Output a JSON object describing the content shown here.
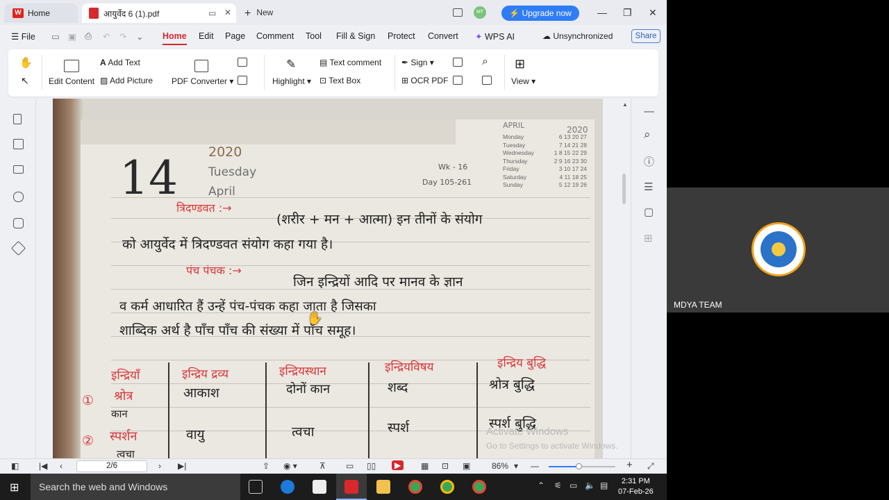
{
  "tabs": {
    "home": "Home",
    "document": "आयुर्वेद 6 (1).pdf",
    "new": "New"
  },
  "avatar_initials": "MT",
  "upgrade": "Upgrade now",
  "menu": {
    "file": "File",
    "home": "Home",
    "edit": "Edit",
    "page": "Page",
    "comment": "Comment",
    "tool": "Tool",
    "fill_sign": "Fill & Sign",
    "protect": "Protect",
    "convert": "Convert",
    "wps_ai": "WPS AI",
    "sync": "Unsynchronized",
    "share": "Share"
  },
  "ribbon": {
    "edit_content": "Edit Content",
    "add_text": "Add Text",
    "add_picture": "Add Picture",
    "pdf_converter": "PDF Converter",
    "highlight": "Highlight",
    "text_comment": "Text comment",
    "text_box": "Text Box",
    "sign": "Sign",
    "ocr_pdf": "OCR PDF",
    "view": "View"
  },
  "document": {
    "day_number": "14",
    "year": "2020",
    "weekday": "Tuesday",
    "month": "April",
    "week": "Wk - 16",
    "day_of_year": "Day 105-261",
    "calendar": {
      "month": "APRIL",
      "year": "2020",
      "rows": [
        [
          "Monday",
          "6 13 20 27"
        ],
        [
          "Tuesday",
          "7 14 21 28"
        ],
        [
          "Wednesday",
          "1 8 15 22 29"
        ],
        [
          "Thursday",
          "2 9 16 23 30"
        ],
        [
          "Friday",
          "3 10 17 24"
        ],
        [
          "Saturday",
          "4 11 18 25"
        ],
        [
          "Sunday",
          "5 12 19 26"
        ]
      ]
    },
    "heading1": "त्रिदण्डवत :→",
    "line1": "(शरीर + मन + आत्मा) इन तीनों के संयोग",
    "line2": "को आयुर्वेद में त्रिदण्डवत संयोग कहा गया है।",
    "heading2": "पंच पंचक :→",
    "line3": "जिन इन्द्रियों आदि पर मानव के ज्ञान",
    "line4": "व कर्म आधारित हैं उन्हें पंच-पंचक कहा जाता है जिसका",
    "line5": "शाब्दिक अर्थ है पाँच पाँच की संख्या में पाँच समूह।",
    "table_headers": [
      "इन्द्रियाँ",
      "इन्द्रिय द्रव्य",
      "इन्द्रियस्थान",
      "इन्द्रियविषय",
      "इन्द्रिय बुद्धि"
    ],
    "row1": {
      "num": "①",
      "organ": "श्रोत्र",
      "organ_sub": "कान",
      "dravya": "आकाश",
      "sthan": "दोनों कान",
      "vishay": "शब्द",
      "buddhi": "श्रोत्र बुद्धि"
    },
    "row2": {
      "num": "②",
      "organ": "स्पर्शन",
      "organ_sub": "त्वचा",
      "dravya": "वायु",
      "sthan": "त्वचा",
      "vishay": "स्पर्श",
      "buddhi": "स्पर्श बुद्धि"
    }
  },
  "watermark": {
    "line1": "Activate Windows",
    "line2": "Go to Settings to activate Windows."
  },
  "status": {
    "page": "2/6",
    "zoom": "86%",
    "zoom_level": 0.45
  },
  "taskbar": {
    "search": "Search the web and Windows",
    "time": "2:31 PM",
    "date": "07-Feb-26"
  },
  "meeting": {
    "name": "MDYA TEAM"
  }
}
